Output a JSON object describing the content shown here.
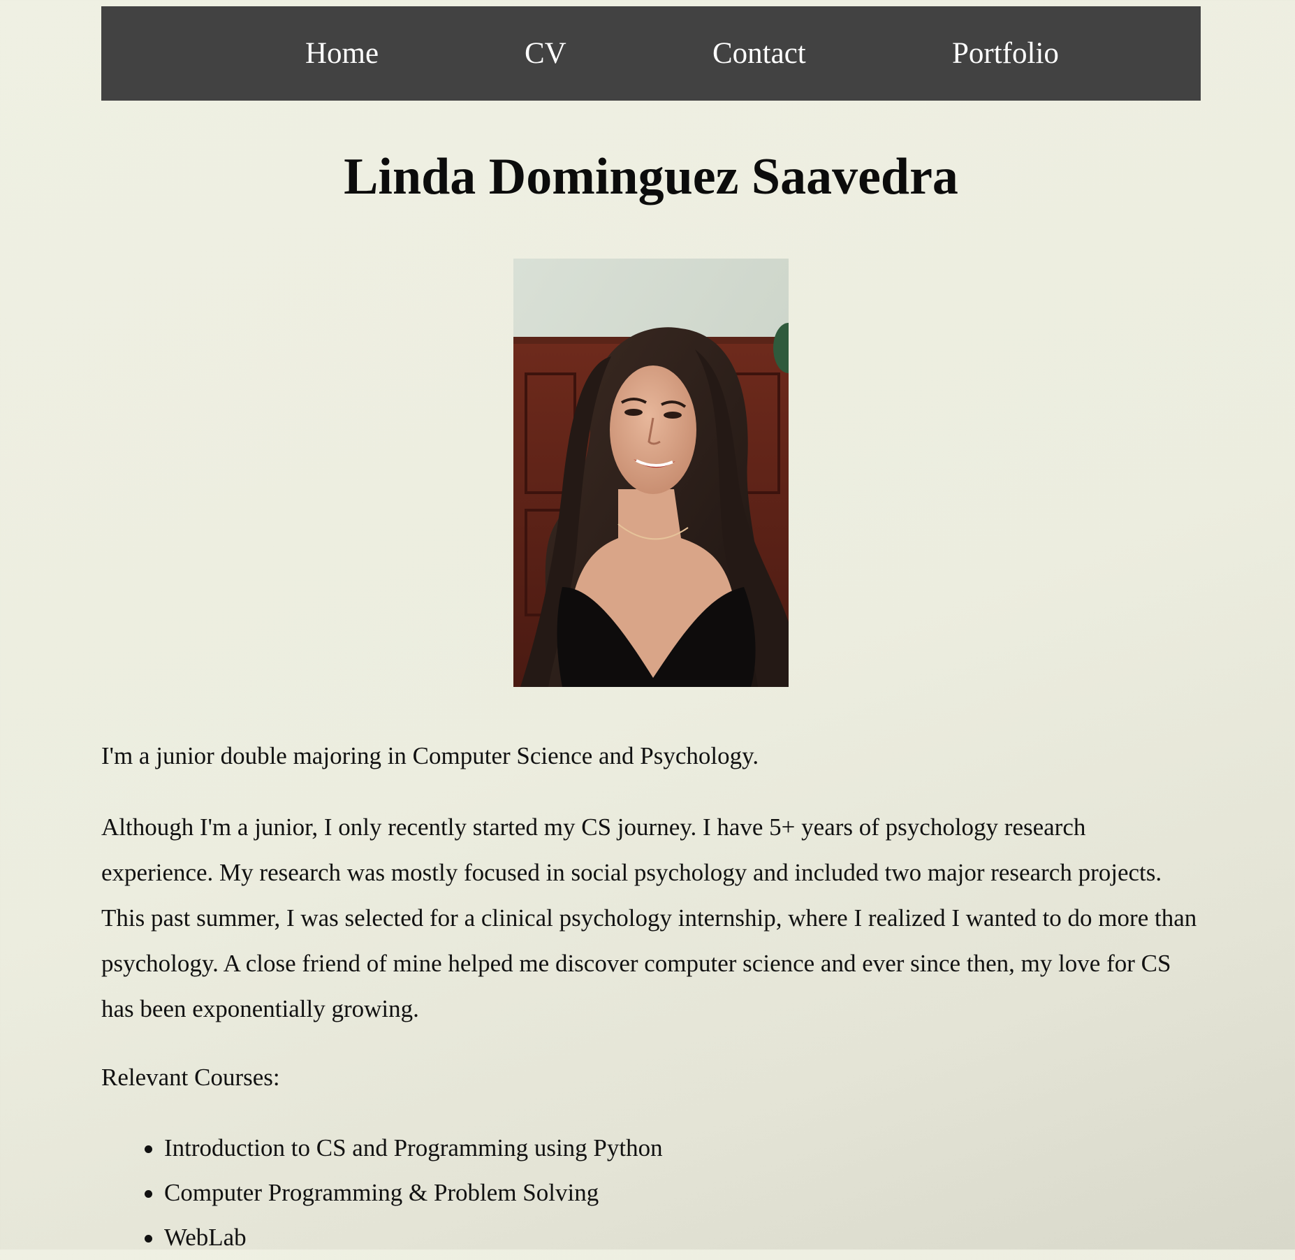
{
  "nav": {
    "home": "Home",
    "cv": "CV",
    "contact": "Contact",
    "portfolio": "Portfolio"
  },
  "header": {
    "title": "Linda Dominguez Saavedra"
  },
  "about": {
    "intro": "I'm a junior double majoring in Computer Science and Psychology.",
    "story": "Although I'm a junior, I only recently started my CS journey. I have 5+ years of psychology research experience. My research was mostly focused in social psychology and included two major research projects. This past summer, I was selected for a clinical psychology internship, where I realized I wanted to do more than psychology. A close friend of mine helped me discover computer science and ever since then, my love for CS has been exponentially growing.",
    "courses_label": "Relevant Courses:"
  },
  "courses": [
    "Introduction to CS and Programming using Python",
    "Computer Programming & Problem Solving",
    "WebLab"
  ],
  "colors": {
    "navbar_bg": "#424242",
    "nav_text": "#ffffff",
    "page_bg": "#eceddf",
    "text": "#111111"
  }
}
